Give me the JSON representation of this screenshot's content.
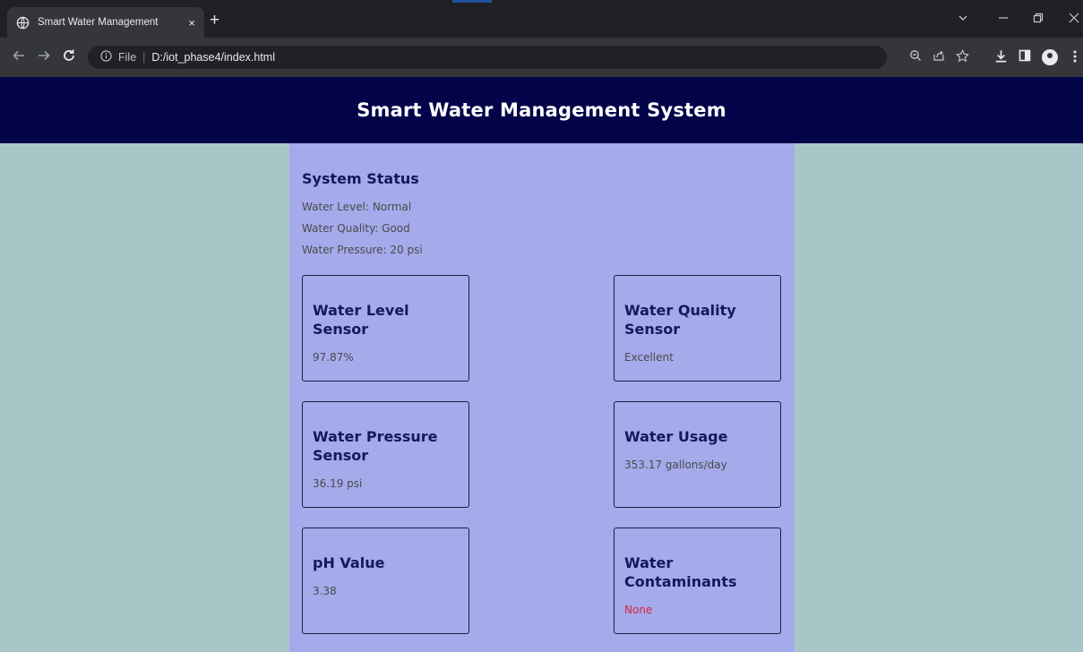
{
  "browser": {
    "tab_title": "Smart Water Management",
    "tab_close": "×",
    "new_tab": "+",
    "url_scheme_label": "File",
    "url_separator": "|",
    "url": "D:/iot_phase4/index.html",
    "icons": [
      "back-icon",
      "forward-icon",
      "reload-icon",
      "info-icon",
      "zoom-icon",
      "share-icon",
      "bookmark-star-icon",
      "download-icon",
      "sidebar-icon",
      "profile-icon",
      "menu-icon"
    ]
  },
  "header": {
    "title": "Smart Water Management System"
  },
  "status": {
    "title": "System Status",
    "lines": [
      "Water Level: Normal",
      "Water Quality: Good",
      "Water Pressure: 20 psi"
    ]
  },
  "cards": [
    {
      "title": "Water Level Sensor",
      "value": "97.87%"
    },
    {
      "title": "Water Quality Sensor",
      "value": "Excellent"
    },
    {
      "title": "Water Pressure Sensor",
      "value": "36.19 psi"
    },
    {
      "title": "Water Usage",
      "value": "353.17 gallons/day"
    },
    {
      "title": "pH Value",
      "value": "3.38"
    },
    {
      "title": "Water Contaminants",
      "value": "None"
    }
  ],
  "colors": {
    "header_bg": "#03034a",
    "page_bg": "#a8c6c8",
    "container_bg": "#a4aaea",
    "alert": "#d4263c"
  }
}
